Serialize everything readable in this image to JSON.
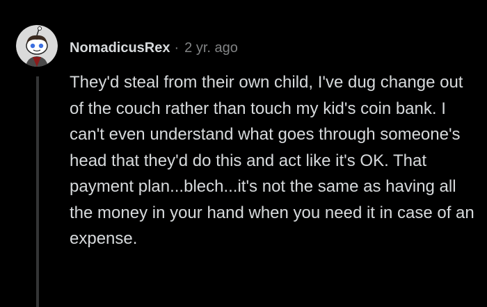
{
  "comment": {
    "username": "NomadicusRex",
    "separator": "·",
    "timestamp": "2 yr. ago",
    "body": "They'd steal from their own child, I've dug change out of the couch rather than touch my kid's coin bank. I can't even understand what goes through someone's head that they'd do this and act like it's OK. That payment plan...blech...it's not the same as having all the money in your hand when you need it in case of an expense."
  },
  "colors": {
    "background": "#000000",
    "text": "#d7dadc",
    "muted": "#818384",
    "thread_line": "#343536",
    "avatar_bg": "#dadada"
  },
  "icons": {
    "avatar": "snoo-avatar-icon"
  }
}
